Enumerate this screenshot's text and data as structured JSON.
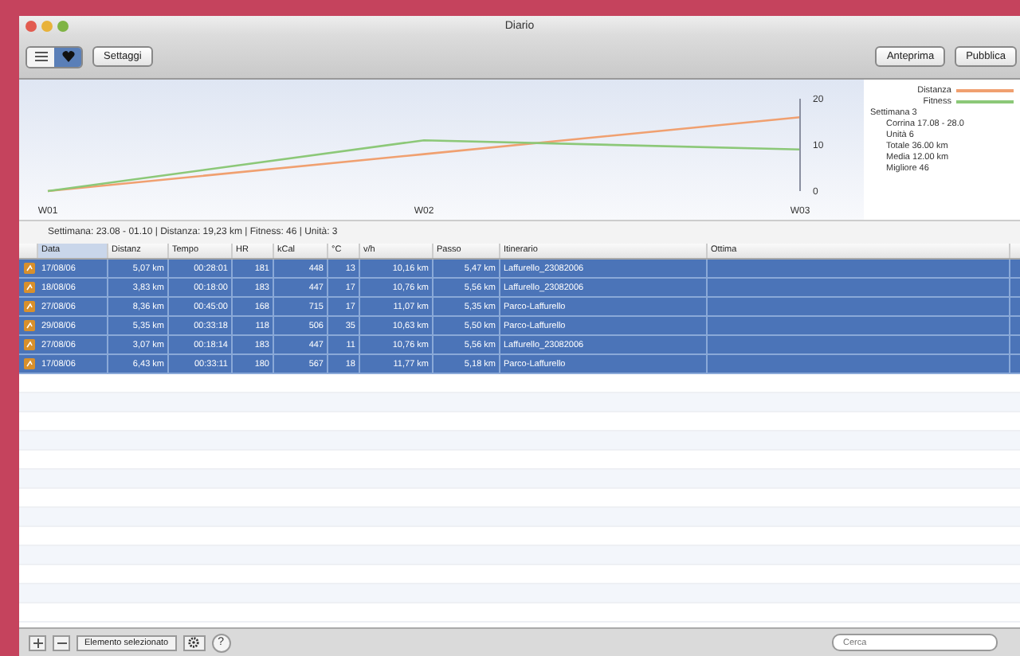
{
  "window": {
    "title": "Diario"
  },
  "toolbar": {
    "views": [
      {
        "selected": false
      },
      {
        "selected": true
      }
    ],
    "left_buttons": [
      "Settaggi"
    ],
    "right_buttons": [
      "Anteprima",
      "Pubblica"
    ]
  },
  "chart": {
    "chart_data": {
      "type": "line",
      "categories": [
        "W01",
        "W02",
        "W03"
      ],
      "yticks": [
        0,
        10,
        20
      ],
      "ylim": [
        0,
        20
      ],
      "series": [
        {
          "name": "Distanza",
          "color": "#f0a070",
          "values": [
            0,
            8,
            16
          ]
        },
        {
          "name": "Fitness",
          "color": "#8cc878",
          "values": [
            0,
            11,
            9
          ]
        }
      ]
    }
  },
  "info": {
    "lines": [
      "Settimana 3",
      "Corrina 17.08 - 28.0",
      "Unità 6",
      "Totale 36.00 km",
      "Media 12.00 km",
      "Migliore 46"
    ]
  },
  "summary": "Settimana: 23.08 - 01.10 | Distanza: 19,23 km | Fitness: 46 | Unità: 3",
  "table": {
    "columns": [
      "Data",
      "Distanz",
      "Tempo",
      "HR",
      "kCal",
      "°C",
      "v/h",
      "Passo",
      "Itinerario",
      "Ottima"
    ],
    "rows": [
      {
        "selected": true,
        "cells": [
          "17/08/06",
          "5,07 km",
          "00:28:01",
          "181",
          "448",
          "13",
          "10,16 km",
          "5,47 km",
          "Laffurello_23082006",
          ""
        ]
      },
      {
        "selected": true,
        "cells": [
          "18/08/06",
          "3,83 km",
          "00:18:00",
          "183",
          "447",
          "17",
          "10,76 km",
          "5,56 km",
          "Laffurello_23082006",
          ""
        ]
      },
      {
        "selected": true,
        "cells": [
          "27/08/06",
          "8,36 km",
          "00:45:00",
          "168",
          "715",
          "17",
          "11,07 km",
          "5,35 km",
          "Parco-Laffurello",
          ""
        ]
      },
      {
        "selected": true,
        "cells": [
          "29/08/06",
          "5,35 km",
          "00:33:18",
          "118",
          "506",
          "35",
          "10,63 km",
          "5,50 km",
          "Parco-Laffurello",
          ""
        ]
      },
      {
        "selected": true,
        "cells": [
          "27/08/06",
          "3,07 km",
          "00:18:14",
          "183",
          "447",
          "11",
          "10,76 km",
          "5,56 km",
          "Laffurello_23082006",
          ""
        ]
      },
      {
        "selected": true,
        "cells": [
          "17/08/06",
          "6,43 km",
          "00:33:11",
          "180",
          "567",
          "18",
          "11,77 km",
          "5,18 km",
          "Parco-Laffurello",
          ""
        ]
      }
    ]
  },
  "bottom_bar": {
    "filter": "Elemento selezionato",
    "help": "?",
    "search": {
      "placeholder": "Cerca"
    }
  }
}
